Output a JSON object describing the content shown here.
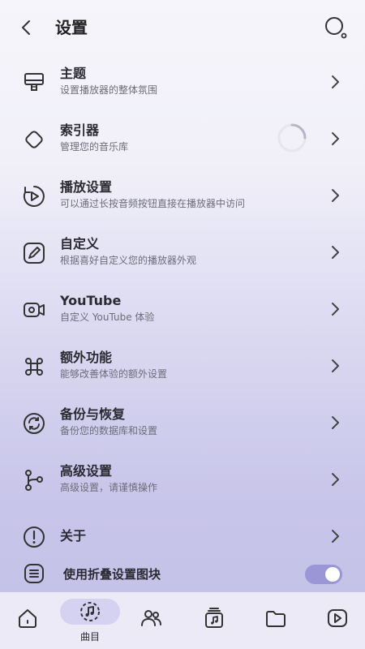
{
  "header": {
    "title": "设置"
  },
  "settings": [
    {
      "title": "主题",
      "subtitle": "设置播放器的整体氛围",
      "icon": "brush-icon"
    },
    {
      "title": "索引器",
      "subtitle": "管理您的音乐库",
      "icon": "diamond-icon"
    },
    {
      "title": "播放设置",
      "subtitle": "可以通过长按音频按钮直接在播放器中访问",
      "icon": "play-circle-icon"
    },
    {
      "title": "自定义",
      "subtitle": "根据喜好自定义您的播放器外观",
      "icon": "pen-icon"
    },
    {
      "title": "YouTube",
      "subtitle": "自定义 YouTube 体验",
      "icon": "video-icon"
    },
    {
      "title": "额外功能",
      "subtitle": "能够改善体验的额外设置",
      "icon": "command-icon"
    },
    {
      "title": "备份与恢复",
      "subtitle": "备份您的数据库和设置",
      "icon": "sync-icon"
    },
    {
      "title": "高级设置",
      "subtitle": "高级设置，请谨慎操作",
      "icon": "branch-icon"
    },
    {
      "title": "关于",
      "icon": "info-icon"
    }
  ],
  "toggle": {
    "label": "使用折叠设置图块",
    "enabled": true,
    "icon": "list-box-icon"
  },
  "nav": {
    "active_label": "曲目"
  },
  "colors": {
    "accent": "#9b97d6",
    "nav_active": "#d5d2f1"
  }
}
